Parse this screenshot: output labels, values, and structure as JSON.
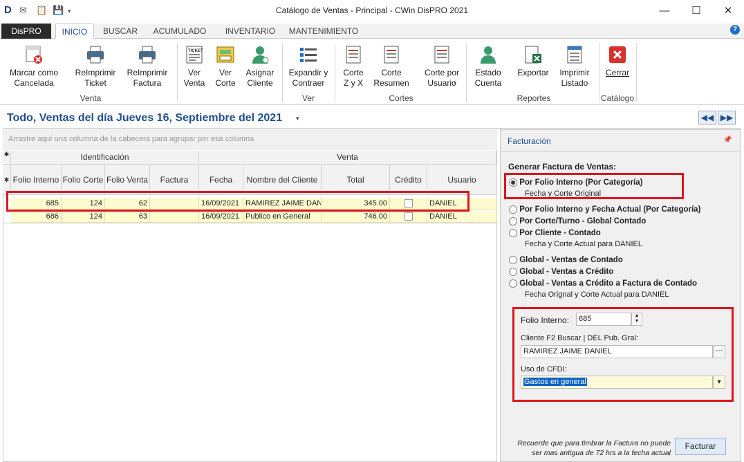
{
  "window": {
    "title": "Catálogo de Ventas - Principal - CWin DisPRO 2021"
  },
  "ribbon_tabs": {
    "app": "DisPRO",
    "tabs": [
      "INICIO",
      "BUSCAR",
      "ACUMULADO",
      "INVENTARIO",
      "MANTENIMIENTO"
    ]
  },
  "ribbon": {
    "marcar": "Marcar como\nCancelada",
    "reimp_ticket": "ReImprimir\nTicket",
    "reimp_factura": "ReImprimir\nFactura",
    "ver_venta": "Ver\nVenta",
    "ver_corte": "Ver\nCorte",
    "asignar": "Asignar\nCliente",
    "expandir": "Expandir y\nContraer",
    "corte_zx": "Corte\nZ y X",
    "corte_res": "Corte\nResumen",
    "corte_usuario": "Corte por\nUsuario",
    "estado": "Estado\nCuenta",
    "exportar": "Exportar",
    "imprimir": "Imprimir\nListado",
    "cerrar": "Cerrar",
    "groups": {
      "venta": "Venta",
      "ver": "Ver",
      "cortes": "Cortes",
      "reportes": "Reportes",
      "catalogo": "Catálogo"
    },
    "ticket_text": "TICKET"
  },
  "page": {
    "title": "Todo, Ventas del día Jueves 16, Septiembre del 2021",
    "group_hint": "Arrastre aquí una columna de la cabecera para agrupar por esa columna"
  },
  "grid": {
    "band_ident": "Identificación",
    "band_venta": "Venta",
    "columns": [
      "Folio Interno",
      "Folio Corte",
      "Folio Venta",
      "Factura",
      "Fecha",
      "Nombre del Cliente",
      "Total",
      "Crédito",
      "Usuario"
    ],
    "rows": [
      {
        "folio": "685",
        "corte": "124",
        "venta": "62",
        "factura": "",
        "fecha": "16/09/2021",
        "cliente": "RAMIREZ JAIME DAN",
        "total": "345.00",
        "usuario": "DANIEL"
      },
      {
        "folio": "686",
        "corte": "124",
        "venta": "63",
        "factura": "",
        "fecha": "16/09/2021",
        "cliente": "Publico en General",
        "total": "746.00",
        "usuario": "DANIEL"
      }
    ]
  },
  "panel": {
    "title": "Facturación",
    "heading": "Generar Factura de Ventas:",
    "opt1": "Por Folio Interno (Por Categoría)",
    "opt1_sub": "Fecha y Corte Original",
    "opt2": "Por Folio Interno y Fecha Actual (Por Categoría)",
    "opt3": "Por Corte/Turno - Global Contado",
    "opt4": "Por Cliente - Contado",
    "opt4_sub": "Fecha y Corte Actual para DANIEL",
    "opt5": "Global  - Ventas de Contado",
    "opt6": "Global  - Ventas a Crédito",
    "opt7": "Global  - Ventas a Crédito a Factura de Contado",
    "opt7_sub": "Fecha Orignal y Corte Actual para DANIEL",
    "folio_label": "Folio Interno:",
    "folio_value": "685",
    "cliente_label": "Cliente   F2 Buscar | DEL  Pub. Gral:",
    "cliente_value": "RAMIREZ JAIME DANIEL",
    "cfdi_label": "Uso de CFDI:",
    "cfdi_value": "Gastos en general",
    "note": "Recuerde que para timbrar la Factura no puede\nser mas antigua de 72 hrs a la fecha actual",
    "facturar": "Facturar"
  }
}
